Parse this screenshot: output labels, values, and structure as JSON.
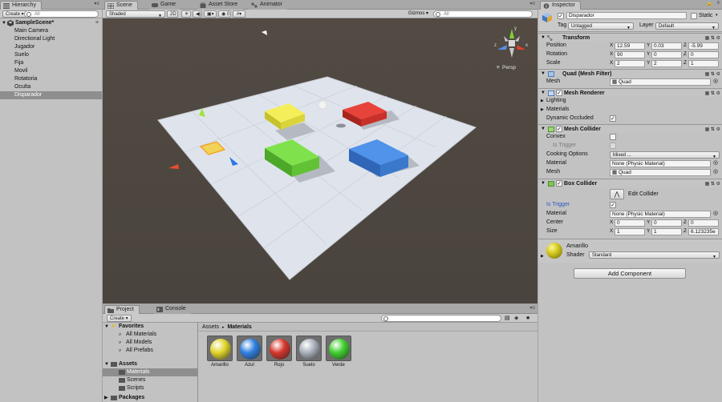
{
  "hierarchy": {
    "tab": "Hierarchy",
    "create_label": "Create",
    "search_placeholder": "All",
    "scene_name": "SampleScene*",
    "items": [
      "Main Camera",
      "Directional Light",
      "Jugador",
      "Suelo",
      "Fija",
      "Movil",
      "Rotatoria",
      "Oculta",
      "Disparador"
    ],
    "selected_index": 8
  },
  "scene": {
    "tabs": [
      "Scene",
      "Game",
      "Asset Store",
      "Animator"
    ],
    "shading": "Shaded",
    "mode_2d": "2D",
    "gizmos": "Gizmos",
    "search_placeholder": "All",
    "persp": "Persp",
    "axis_y": "y",
    "axis_x": "x",
    "axis_z": "z",
    "colors": {
      "background": "#4d4741",
      "floor": "#dfe4ec",
      "yellow": "#e1dc3b",
      "red": "#d2332b",
      "green": "#6cce3c",
      "blue": "#3f80d6"
    }
  },
  "inspector": {
    "tab": "Inspector",
    "object_name": "Disparador",
    "static_label": "Static",
    "tag_label": "Tag",
    "tag_value": "Untagged",
    "layer_label": "Layer",
    "layer_value": "Default",
    "transform": {
      "title": "Transform",
      "position_label": "Position",
      "position": {
        "x": "12.59",
        "y": "0.03",
        "z": "-5.99"
      },
      "rotation_label": "Rotation",
      "rotation": {
        "x": "90",
        "y": "0",
        "z": "0"
      },
      "scale_label": "Scale",
      "scale": {
        "x": "2",
        "y": "2",
        "z": "1"
      }
    },
    "mesh_filter": {
      "title": "Quad (Mesh Filter)",
      "mesh_label": "Mesh",
      "mesh_value": "Quad"
    },
    "mesh_renderer": {
      "title": "Mesh Renderer",
      "lighting": "Lighting",
      "materials": "Materials",
      "dynamic_occluded": "Dynamic Occluded"
    },
    "mesh_collider": {
      "title": "Mesh Collider",
      "convex": "Convex",
      "is_trigger": "Is Trigger",
      "cooking_label": "Cooking Options",
      "cooking_value": "Mixed ...",
      "material_label": "Material",
      "material_value": "None (Physic Material)",
      "mesh_label": "Mesh",
      "mesh_value": "Quad"
    },
    "box_collider": {
      "title": "Box Collider",
      "edit_collider": "Edit Collider",
      "is_trigger": "Is Trigger",
      "material_label": "Material",
      "material_value": "None (Physic Material)",
      "center_label": "Center",
      "center": {
        "x": "0",
        "y": "0",
        "z": "0"
      },
      "size_label": "Size",
      "size": {
        "x": "1",
        "y": "1",
        "z": "6.123235e"
      }
    },
    "material": {
      "name": "Amarillo",
      "shader_label": "Shader",
      "shader_value": "Standard"
    },
    "add_component": "Add Component"
  },
  "project": {
    "tabs": [
      "Project",
      "Console"
    ],
    "create_label": "Create",
    "favorites": "Favorites",
    "fav_items": [
      "All Materials",
      "All Models",
      "All Prefabs"
    ],
    "assets": "Assets",
    "asset_folders": [
      "Materials",
      "Scenes",
      "Scripts"
    ],
    "packages": "Packages",
    "breadcrumb": {
      "root": "Assets",
      "sep": "▸",
      "current": "Materials"
    },
    "materials": [
      {
        "name": "Amarillo",
        "color": "#e0d52a"
      },
      {
        "name": "Azul",
        "color": "#2f7fe0"
      },
      {
        "name": "Rojo",
        "color": "#d6372c"
      },
      {
        "name": "Suelo",
        "color": "#a9b0bb"
      },
      {
        "name": "Verde",
        "color": "#3fcf2e"
      }
    ]
  }
}
